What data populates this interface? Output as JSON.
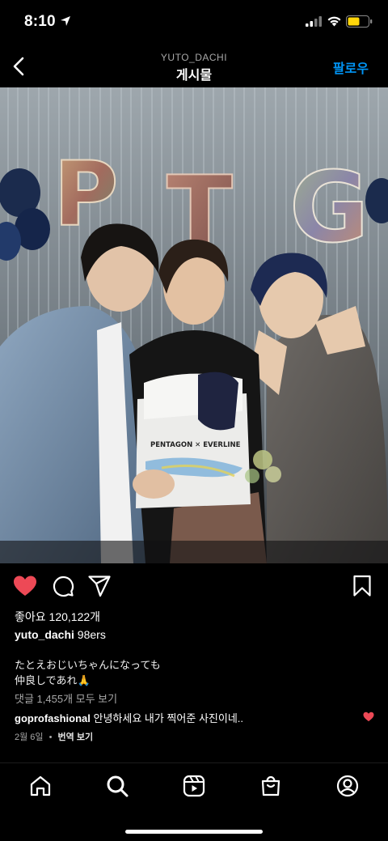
{
  "status_bar": {
    "time": "8:10"
  },
  "nav": {
    "subtitle": "YUTO_DACHI",
    "title": "게시물",
    "follow_label": "팔로우"
  },
  "photo": {
    "balloon_letters": [
      "P",
      "T",
      "G"
    ],
    "cake_text": "PENTAGON ✕ EVERLINE"
  },
  "post": {
    "likes": "좋아요 120,122개",
    "author": "yuto_dachi",
    "author_sub": "98ers",
    "caption_line1": "たとえおじいちゃんになっても",
    "caption_line2": "仲良しであれ🙏",
    "comments_link": "댓글 1,455개 모두 보기",
    "comment_user": "goprofashional",
    "comment_text": "안녕하세요 내가 찍어준 사진이네..",
    "date": "2월 6일",
    "separator": "•",
    "translate_label": "번역 보기"
  },
  "colors": {
    "liked_heart": "#ed4956",
    "link_blue": "#0095f6"
  },
  "icons": {
    "tabs": [
      "home-icon",
      "search-icon",
      "reels-icon",
      "shop-icon",
      "profile-icon"
    ]
  }
}
